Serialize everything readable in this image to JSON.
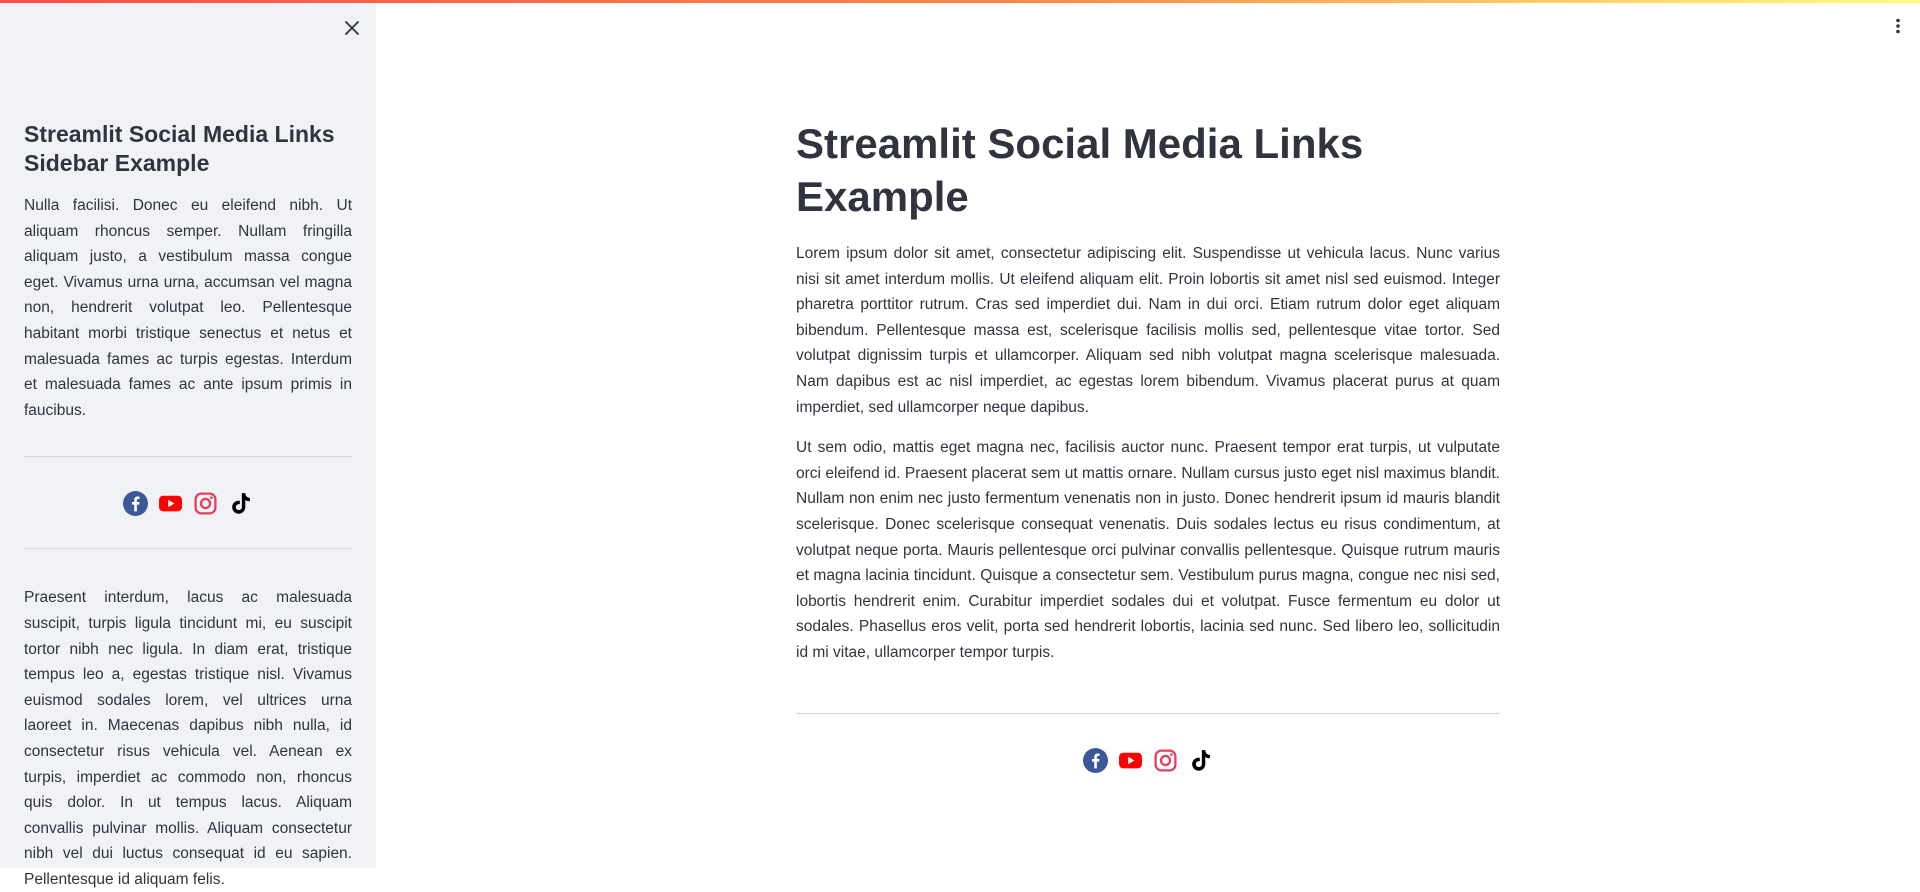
{
  "sidebar": {
    "title": "Streamlit Social Media Links Sidebar Example",
    "paragraph1": "Nulla facilisi. Donec eu eleifend nibh. Ut aliquam rhoncus semper. Nullam fringilla aliquam justo, a vestibulum massa congue eget. Vivamus urna urna, accumsan vel magna non, hendrerit volutpat leo. Pellentesque habitant morbi tristique senectus et netus et malesuada fames ac turpis egestas. Interdum et malesuada fames ac ante ipsum primis in faucibus.",
    "paragraph2": "Praesent interdum, lacus ac malesuada suscipit, turpis ligula tincidunt mi, eu suscipit tortor nibh nec ligula. In diam erat, tristique tempus leo a, egestas tristique nisl. Vivamus euismod sodales lorem, vel ultrices urna laoreet in. Maecenas dapibus nibh nulla, id consectetur risus vehicula vel. Aenean ex turpis, imperdiet ac commodo non, rhoncus quis dolor. In ut tempus lacus. Aliquam convallis pulvinar mollis. Aliquam consectetur nibh vel dui luctus consequat id eu sapien. Pellentesque id aliquam felis."
  },
  "main": {
    "title": "Streamlit Social Media Links Example",
    "paragraph1": "Lorem ipsum dolor sit amet, consectetur adipiscing elit. Suspendisse ut vehicula lacus. Nunc varius nisi sit amet interdum mollis. Ut eleifend aliquam elit. Proin lobortis sit amet nisl sed euismod. Integer pharetra porttitor rutrum. Cras sed imperdiet dui. Nam in dui orci. Etiam rutrum dolor eget aliquam bibendum. Pellentesque massa est, scelerisque facilisis mollis sed, pellentesque vitae tortor. Sed volutpat dignissim turpis et ullamcorper. Aliquam sed nibh volutpat magna scelerisque malesuada. Nam dapibus est ac nisl imperdiet, ac egestas lorem bibendum. Vivamus placerat purus at quam imperdiet, sed ullamcorper neque dapibus.",
    "paragraph2": "Ut sem odio, mattis eget magna nec, facilisis auctor nunc. Praesent tempor erat turpis, ut vulputate orci eleifend id. Praesent placerat sem ut mattis ornare. Nullam cursus justo eget nisl maximus blandit. Nullam non enim nec justo fermentum venenatis non in justo. Donec hendrerit ipsum id mauris blandit scelerisque. Donec scelerisque consequat venenatis. Duis sodales lectus eu risus condimentum, at volutpat neque porta. Mauris pellentesque orci pulvinar convallis pellentesque. Quisque rutrum mauris et magna lacinia tincidunt. Quisque a consectetur sem. Vestibulum purus magna, congue nec nisi sed, lobortis hendrerit enim. Curabitur imperdiet sodales dui et volutpat. Fusce fermentum eu dolor ut sodales. Phasellus eros velit, porta sed hendrerit lobortis, lacinia sed nunc. Sed libero leo, sollicitudin id mi vitae, ullamcorper tempor turpis."
  },
  "social_icons": [
    {
      "name": "facebook-icon",
      "color": "#3b5998"
    },
    {
      "name": "youtube-icon",
      "color": "#ff0000"
    },
    {
      "name": "instagram-icon",
      "color": "#e4405f"
    },
    {
      "name": "tiktok-icon",
      "color": "#000000"
    }
  ],
  "colors": {
    "sidebar_bg": "#f0f2f6",
    "text": "#31333f",
    "accent": "#ff4b4b"
  }
}
